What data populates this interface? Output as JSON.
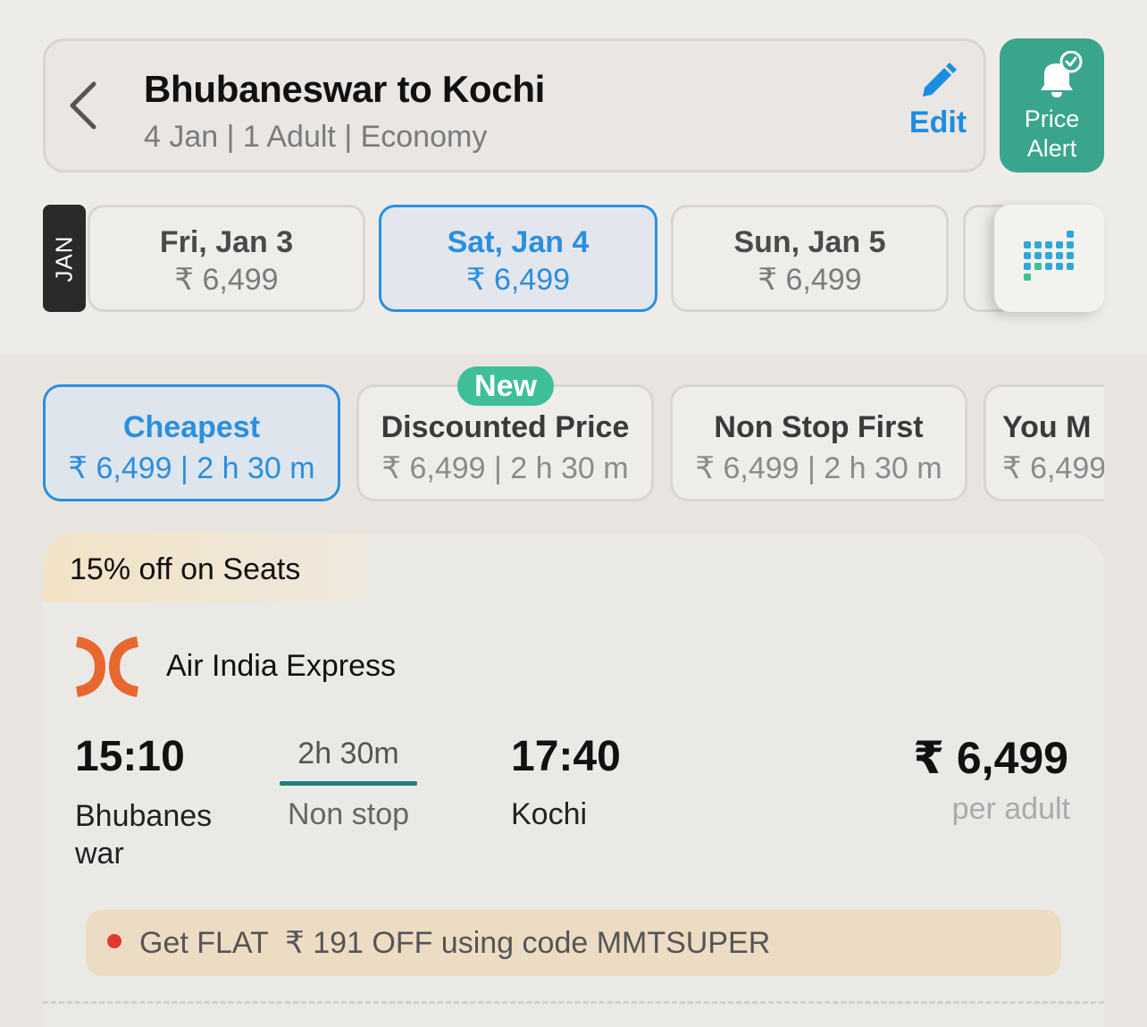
{
  "header": {
    "route_title": "Bhubaneswar to Kochi",
    "route_subtitle": "4 Jan | 1 Adult | Economy",
    "edit_label": "Edit",
    "price_alert_line1": "Price",
    "price_alert_line2": "Alert"
  },
  "date_strip": {
    "month": "JAN",
    "dates": [
      {
        "day": "Fri, Jan 3",
        "price": "₹ 6,499",
        "selected": false
      },
      {
        "day": "Sat, Jan 4",
        "price": "₹ 6,499",
        "selected": true
      },
      {
        "day": "Sun, Jan 5",
        "price": "₹ 6,499",
        "selected": false
      }
    ]
  },
  "sort_tabs": {
    "new_badge": "New",
    "tabs": [
      {
        "title": "Cheapest",
        "meta": "₹ 6,499 | 2 h 30 m",
        "selected": true
      },
      {
        "title": "Discounted Price",
        "meta": "₹ 6,499 | 2 h 30 m",
        "selected": false
      },
      {
        "title": "Non Stop First",
        "meta": "₹ 6,499 | 2 h 30 m",
        "selected": false
      },
      {
        "title": "You M",
        "meta": "₹ 6,499",
        "selected": false
      }
    ]
  },
  "flight": {
    "offer": "15% off on Seats",
    "airline": "Air India Express",
    "departure_time": "15:10",
    "departure_city": "Bhubaneswar",
    "duration": "2h 30m",
    "stops": "Non stop",
    "arrival_time": "17:40",
    "arrival_city": "Kochi",
    "price": "₹ 6,499",
    "price_unit": "per adult",
    "coupon": "Get FLAT  ₹ 191 OFF using code MMTSUPER"
  },
  "colors": {
    "accent_blue": "#2b8fe0",
    "price_alert_green": "#3aa58d",
    "new_badge_green": "#3fbf98",
    "duration_line": "#1f7f7a",
    "airline_logo": "#e8672f",
    "coupon_dot": "#e23a2e"
  }
}
